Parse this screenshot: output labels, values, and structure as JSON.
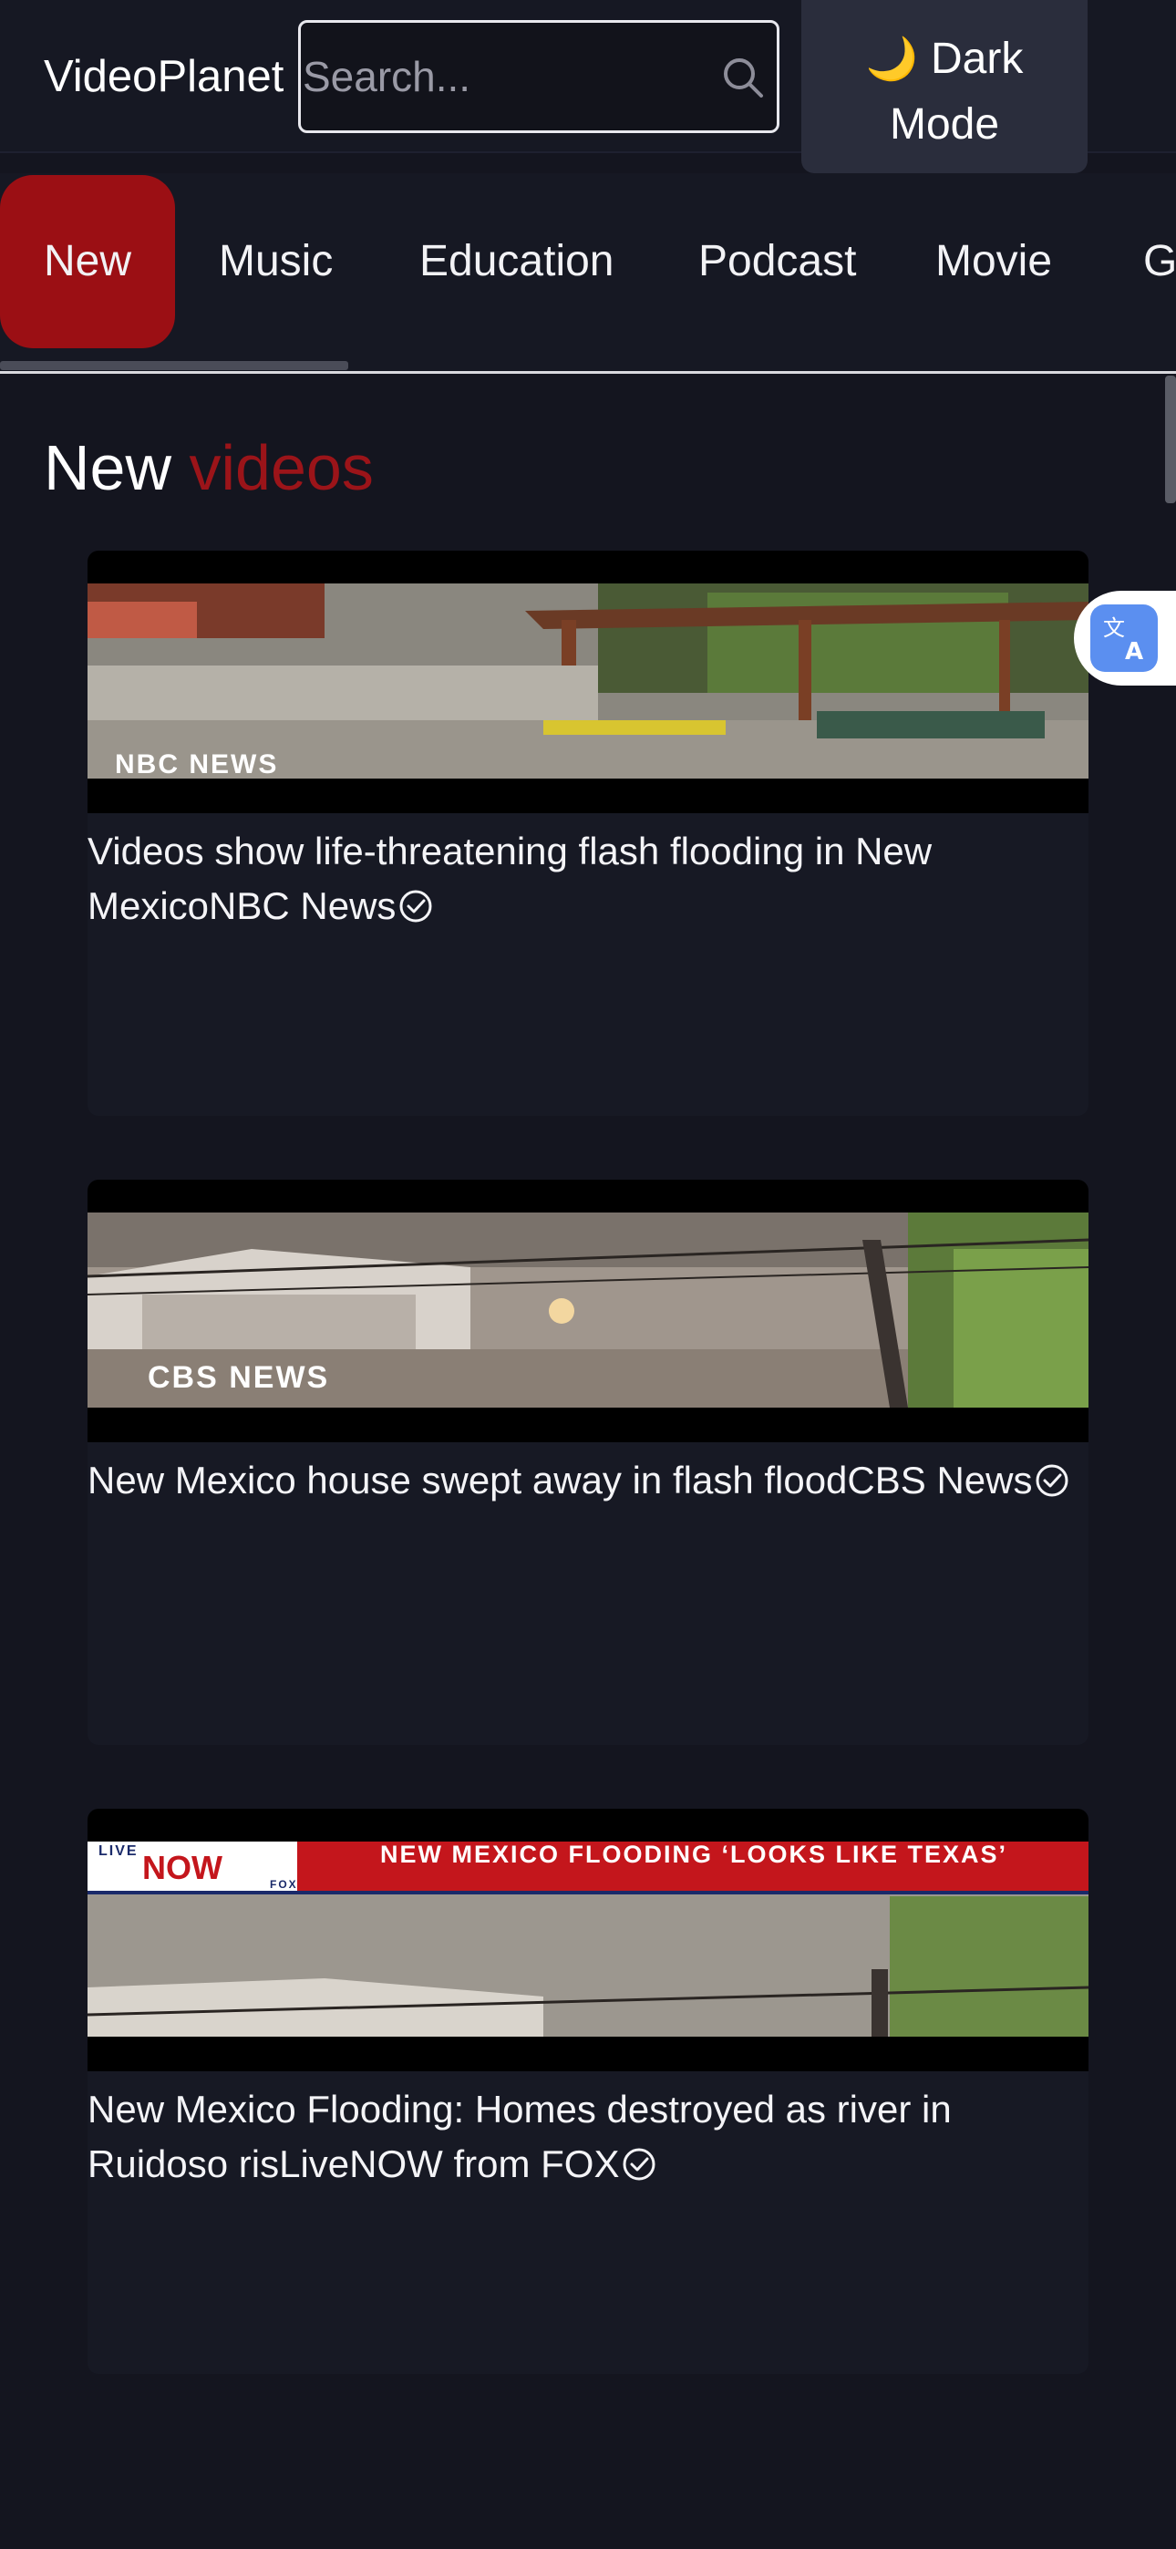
{
  "app": {
    "name": "VideoPlanet"
  },
  "search": {
    "placeholder": "Search..."
  },
  "theme_toggle": {
    "icon": "moon-icon",
    "label_line1": "Dark",
    "label_line2": "Mode"
  },
  "tabs": [
    {
      "label": "New",
      "active": true
    },
    {
      "label": "Music",
      "active": false
    },
    {
      "label": "Education",
      "active": false
    },
    {
      "label": "Podcast",
      "active": false
    },
    {
      "label": "Movie",
      "active": false
    },
    {
      "label": "Ga",
      "active": false
    }
  ],
  "section": {
    "title": "New",
    "title_accent": "videos"
  },
  "videos": [
    {
      "title": "Videos show life-threatening flash flooding in New Mexico",
      "channel": "NBC News",
      "verified": true,
      "thumbnail_overlay": "NBC NEWS"
    },
    {
      "title": "New Mexico house swept away in flash flood",
      "channel": "CBS News",
      "verified": true,
      "thumbnail_overlay": "CBS NEWS"
    },
    {
      "title": "New Mexico Flooding: Homes destroyed as river in Ruidoso ris",
      "channel": "LiveNOW from FOX",
      "verified": true,
      "thumbnail_overlay": "NEW MEXICO FLOODING ‘LOOKS LIKE TEXAS’",
      "thumbnail_badge_top": "LIVE",
      "thumbnail_badge_main": "NOW",
      "thumbnail_badge_sub": "FOX"
    }
  ],
  "colors": {
    "background": "#14151f",
    "accent": "#9b0f14",
    "header": "#161823",
    "button": "#2a2d3c",
    "translate_button": "#5b8ff0"
  }
}
